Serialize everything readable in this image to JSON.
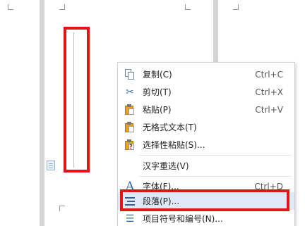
{
  "context_menu": {
    "items": [
      {
        "label": "复制(C)",
        "shortcut": "Ctrl+C",
        "icon": "copy-icon"
      },
      {
        "label": "剪切(T)",
        "shortcut": "Ctrl+X",
        "icon": "scissors-icon"
      },
      {
        "label": "粘贴(P)",
        "shortcut": "Ctrl+V",
        "icon": "paste-icon"
      },
      {
        "label": "无格式文本(T)",
        "shortcut": "",
        "icon": "paste-plain-icon"
      },
      {
        "label": "选择性粘贴(S)...",
        "shortcut": "",
        "icon": "paste-special-icon"
      },
      {
        "label": "汉字重选(V)",
        "shortcut": "",
        "icon": ""
      },
      {
        "label": "字体(F)...",
        "shortcut": "Ctrl+D",
        "icon": "font-icon"
      },
      {
        "label": "段落(P)...",
        "shortcut": "",
        "icon": "paragraph-icon"
      },
      {
        "label": "项目符号和编号(N)...",
        "shortcut": "",
        "icon": "list-icon"
      }
    ]
  },
  "colors": {
    "highlight_border": "#e01515",
    "icon_blue": "#3a6fb5",
    "menu_hover": "#dfe8f6"
  }
}
